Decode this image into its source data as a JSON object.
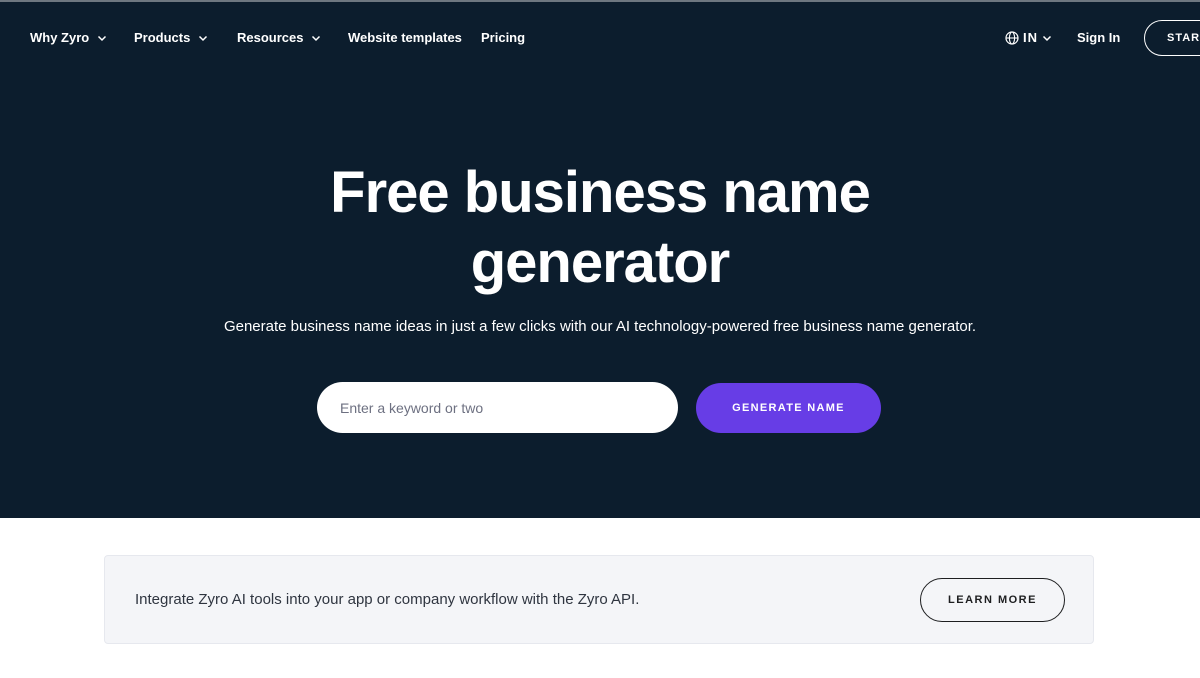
{
  "nav": {
    "items": [
      {
        "label": "Why Zyro",
        "has_dropdown": true
      },
      {
        "label": "Products",
        "has_dropdown": true
      },
      {
        "label": "Resources",
        "has_dropdown": true
      },
      {
        "label": "Website templates",
        "has_dropdown": false
      },
      {
        "label": "Pricing",
        "has_dropdown": false
      }
    ],
    "language": {
      "label": "IN",
      "icon": "globe-icon"
    },
    "sign_in": "Sign In",
    "start_button": "START"
  },
  "hero": {
    "title_line1": "Free business name",
    "title_line2": "generator",
    "subtitle": "Generate business name ideas in just a few clicks with our AI technology-powered free business name generator.",
    "search_placeholder": "Enter a keyword or two",
    "search_value": "",
    "generate_button": "GENERATE NAME"
  },
  "api_banner": {
    "text": "Integrate Zyro AI tools into your app or company workflow with the Zyro API.",
    "button": "LEARN MORE"
  },
  "colors": {
    "hero_bg": "#0c1d2d",
    "accent": "#673de6",
    "banner_bg": "#f4f5f8"
  }
}
